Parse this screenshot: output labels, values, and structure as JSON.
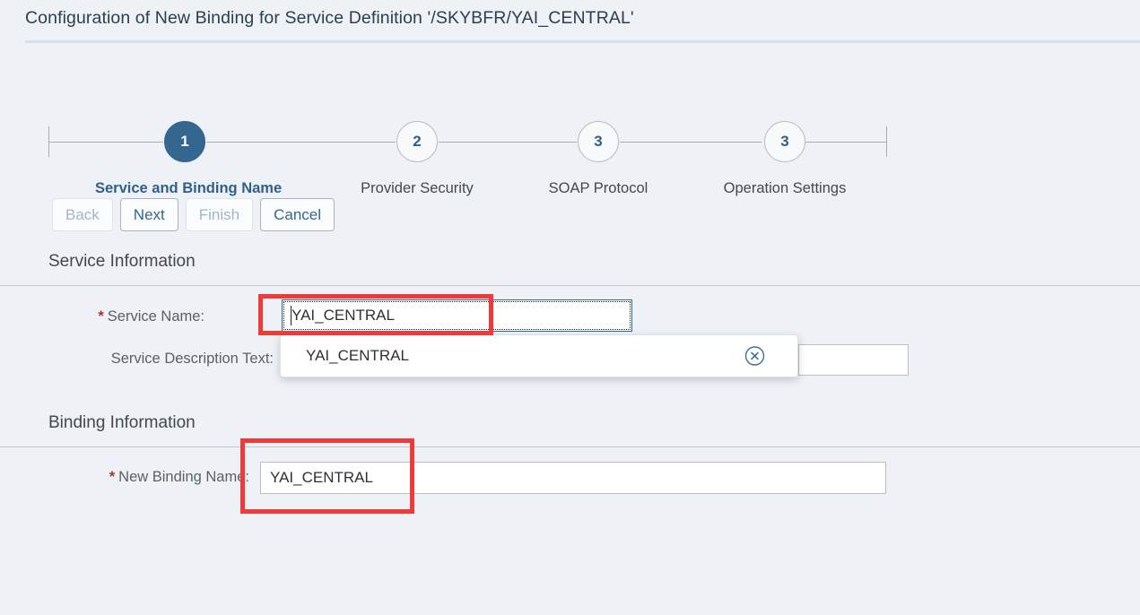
{
  "header": {
    "title": "Configuration of New Binding for Service Definition '/SKYBFR/YAI_CENTRAL'"
  },
  "wizard": {
    "steps": [
      {
        "number": "1",
        "label": "Service and Binding Name",
        "state": "active"
      },
      {
        "number": "2",
        "label": "Provider Security",
        "state": "idle"
      },
      {
        "number": "3",
        "label": "SOAP Protocol",
        "state": "idle"
      },
      {
        "number": "3",
        "label": "Operation Settings",
        "state": "idle"
      }
    ]
  },
  "toolbar": {
    "back_label": "Back",
    "next_label": "Next",
    "finish_label": "Finish",
    "cancel_label": "Cancel"
  },
  "service_information": {
    "section_title": "Service Information",
    "service_name_label": "Service Name:",
    "service_name_value": "YAI_CENTRAL",
    "description_label": "Service Description Text:",
    "description_value": ""
  },
  "suggestion": {
    "item_text": "YAI_CENTRAL",
    "clear_icon": "clear-circle-icon"
  },
  "binding_information": {
    "section_title": "Binding Information",
    "new_binding_name_label": "New Binding Name:",
    "new_binding_name_value": "YAI_CENTRAL"
  },
  "required_marker": "*",
  "colors": {
    "background": "#eef2f6",
    "accent": "#33678f",
    "annotation": "#ef3a3a",
    "required": "#ae3434",
    "disabled_text": "#a3b5c8"
  }
}
